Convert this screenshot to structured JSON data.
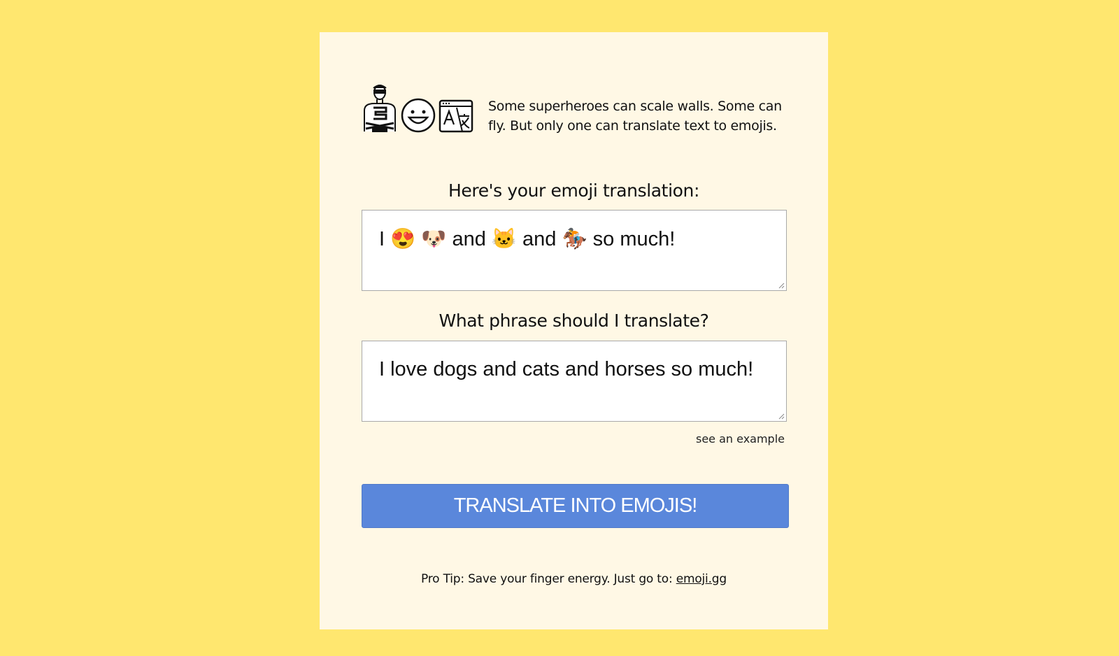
{
  "intro": {
    "icons": [
      "superhero-icon",
      "grinning-face-icon",
      "translate-icon"
    ],
    "text": "Some superheroes can scale walls. Some can fly. But only one can translate text to emojis."
  },
  "output": {
    "label": "Here's your emoji translation:",
    "value": "I 😍 🐶 and 🐱 and 🏇 so much!"
  },
  "input": {
    "label": "What phrase should I translate?",
    "value": "I love dogs and cats and horses so much!"
  },
  "example_link": "see an example",
  "translate_button": "TRANSLATE INTO EMOJIS!",
  "tip": {
    "prefix": "Pro Tip: Save your finger energy. Just go to: ",
    "link": "emoji.gg"
  },
  "colors": {
    "background": "#ffe76f",
    "card": "#fff8e5",
    "button": "#5a87db"
  }
}
